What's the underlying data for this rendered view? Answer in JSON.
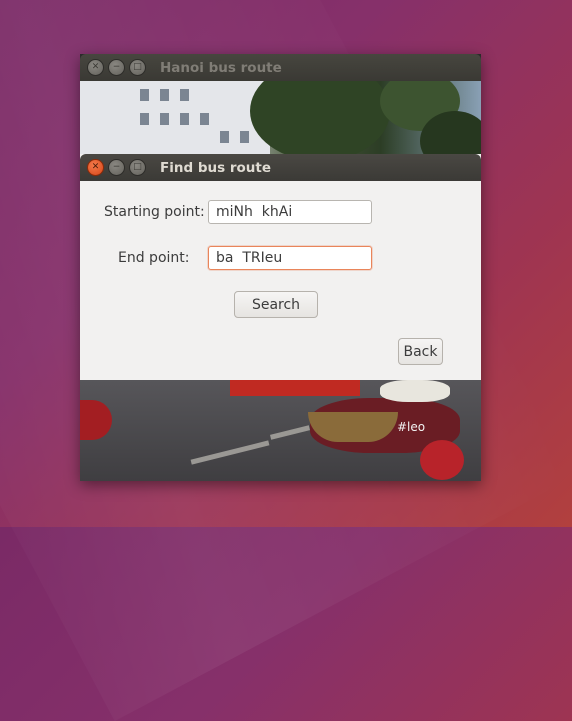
{
  "outer_window": {
    "title": "Hanoi bus route",
    "watermark": "#leo"
  },
  "dialog": {
    "title": "Find bus route",
    "start_label": "Starting point:",
    "start_value": "miNh  khAi",
    "end_label": "End point:",
    "end_value": "ba  TRIeu",
    "search_label": "Search",
    "back_label": "Back"
  },
  "colors": {
    "close_button_active": "#e0561f",
    "focus_border": "#e9855a",
    "dialog_background": "#f2f1f0"
  }
}
